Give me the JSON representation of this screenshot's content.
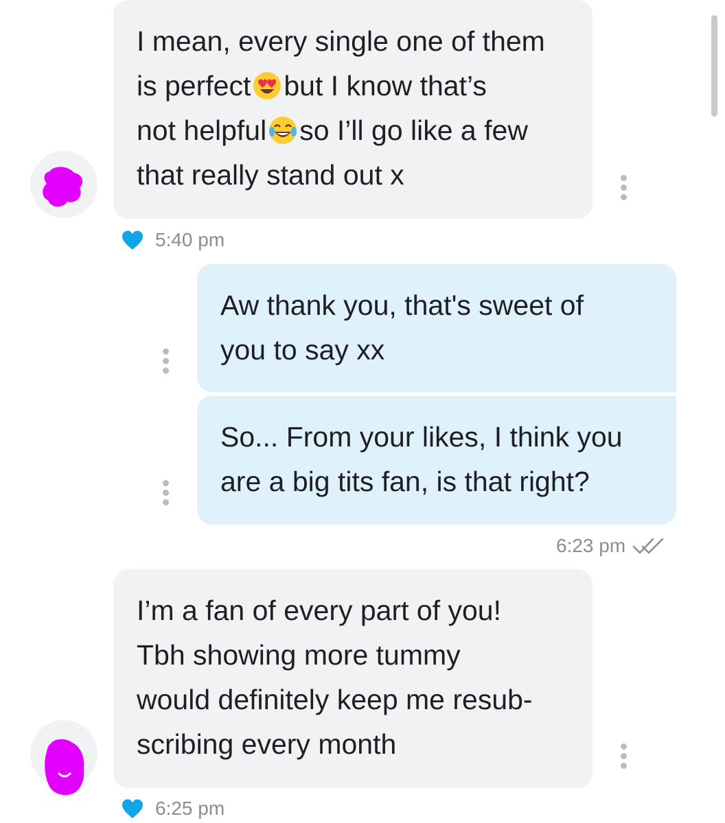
{
  "colors": {
    "incoming_bubble": "#f1f2f4",
    "outgoing_bubble": "#dff1fb",
    "like_heart": "#10a5e8",
    "avatar_scribble": "#e400ff",
    "timestamp_text": "#8a8d92"
  },
  "messages": [
    {
      "direction": "incoming",
      "lines": [
        "I mean, every single one of them",
        "is perfect",
        "but I know that’s",
        "not helpful",
        "so I’ll go like a few",
        "that really stand out x"
      ],
      "emojis": [
        "heart-eyes-emoji",
        "tears-of-joy-emoji"
      ],
      "liked": true,
      "liked_icon": "heart-icon",
      "time": "5:40 pm"
    },
    {
      "direction": "outgoing",
      "lines": [
        "Aw thank you, that's sweet of",
        "you to say xx"
      ]
    },
    {
      "direction": "outgoing",
      "lines": [
        "So... From your likes, I think you",
        "are a big tits fan, is that right?"
      ],
      "time": "6:23 pm",
      "status_icon": "double-check-icon"
    },
    {
      "direction": "incoming",
      "lines": [
        "I’m a fan of every part of you!",
        "Tbh showing more tummy",
        "would definitely keep me resub-",
        "scribing every month"
      ],
      "liked": true,
      "liked_icon": "heart-icon",
      "time": "6:25 pm"
    }
  ]
}
